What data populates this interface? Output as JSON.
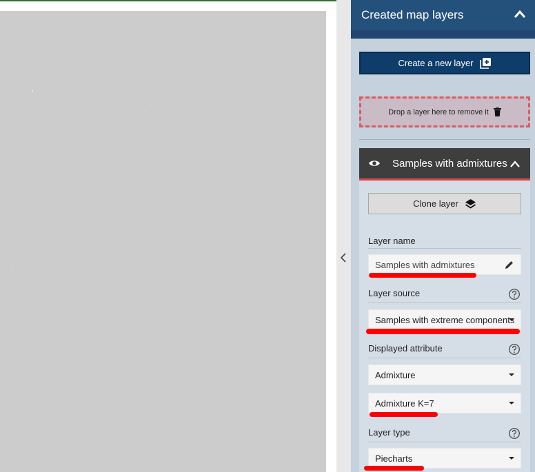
{
  "panel": {
    "title": "Created map layers",
    "create_layer_label": "Create a new layer",
    "drop_zone_label": "Drop a layer here to remove it"
  },
  "layer": {
    "title": "Samples with admixtures",
    "clone_label": "Clone layer",
    "name_label": "Layer name",
    "name_value": "Samples with admixtures",
    "source_label": "Layer source",
    "source_value": "Samples with extreme components",
    "attribute_label": "Displayed attribute",
    "attribute_value": "Admixture",
    "attribute_sub_value": "Admixture K=7",
    "type_label": "Layer type",
    "type_value": "Piecharts"
  },
  "icons": {
    "collapse": "chevron-up-icon",
    "sidebar_toggle": "chevron-left-icon",
    "create": "add-box-icon",
    "drop": "trash-icon",
    "visibility": "eye-icon",
    "clone": "layers-icon",
    "edit": "pencil-icon",
    "help": "help-circle-icon"
  },
  "colors": {
    "header": "#24507c",
    "create_button": "#0e3d6b",
    "layer_header": "#3e3e3e",
    "drop_border": "#dc5a5f",
    "annotation": "#ff0000"
  }
}
